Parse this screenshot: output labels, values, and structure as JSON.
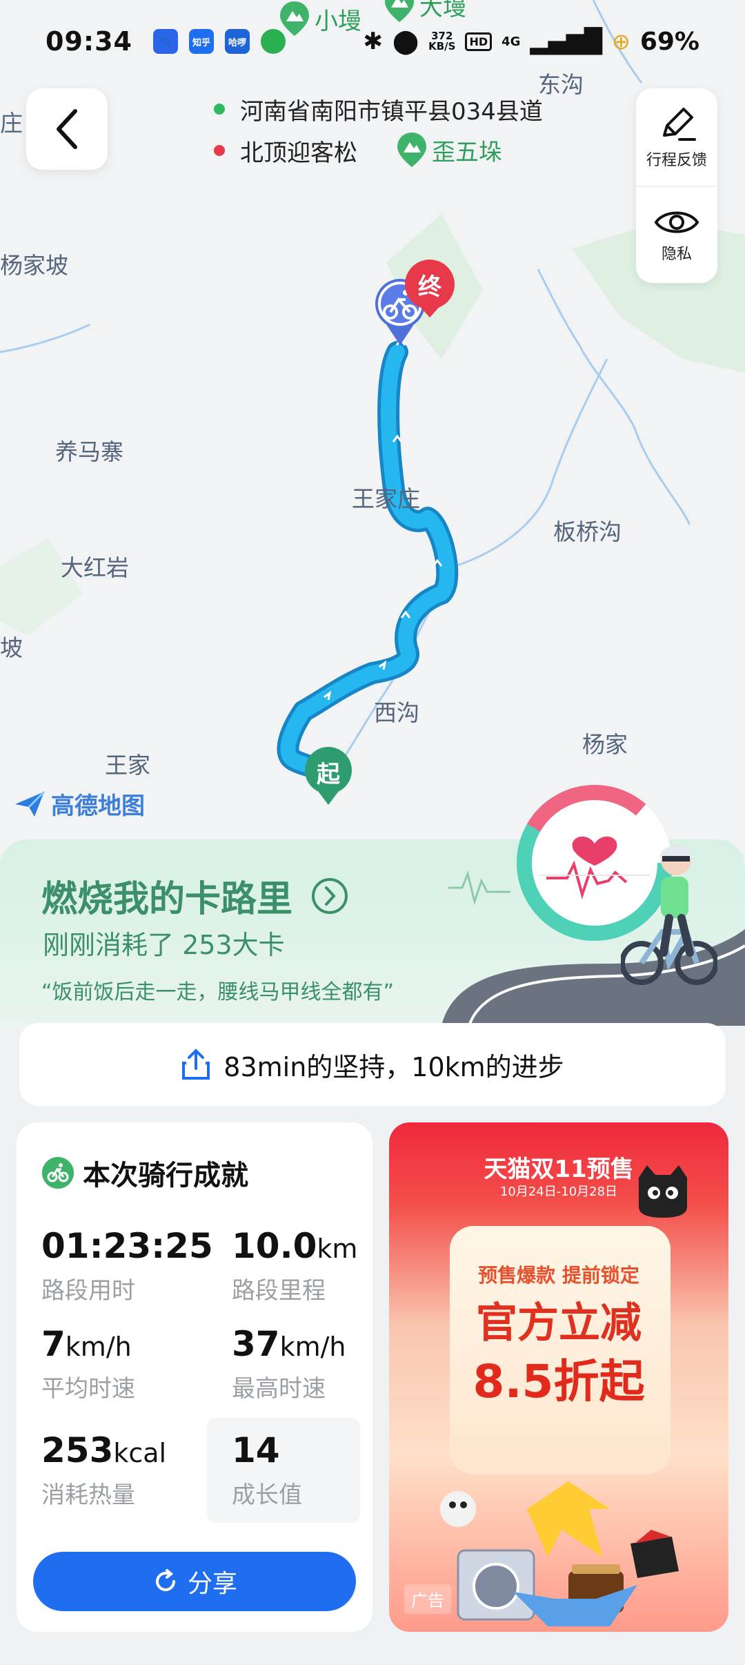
{
  "status_bar": {
    "time": "09:34",
    "apps": [
      {
        "name": "baidu-icon",
        "text": "🐾",
        "color": "#2a65e8"
      },
      {
        "name": "zhihu-icon",
        "text": "知乎",
        "color": "#1f6ef0"
      },
      {
        "name": "hello-icon",
        "text": "哈啰",
        "color": "#1e64d7"
      },
      {
        "name": "message-icon",
        "text": "",
        "color": "#2bb04f"
      }
    ],
    "net_speed_value": "372",
    "net_speed_unit": "KB/S",
    "hd": "HD",
    "network": "4G",
    "battery": "69%"
  },
  "map": {
    "start_address": "河南省南阳市镇平县034县道",
    "end_address": "北顶迎客松",
    "place_labels": [
      "庄",
      "东沟",
      "杨家坡",
      "养马寨",
      "王家庄",
      "板桥沟",
      "大红岩",
      "西沟",
      "杨家",
      "王家",
      "坡"
    ],
    "poi_labels": [
      "小墁",
      "大墁",
      "歪五垛"
    ],
    "end_marker": "终",
    "start_marker": "起",
    "provider": "高德地图"
  },
  "side_panel": {
    "feedback": "行程反馈",
    "privacy": "隐私"
  },
  "calorie": {
    "title": "燃烧我的卡路里",
    "subtitle": "刚刚消耗了 253大卡",
    "quote": "“饭前饭后走一走，腰线马甲线全都有”"
  },
  "share_strip": "83min的坚持，10km的进步",
  "achievement": {
    "title": "本次骑行成就",
    "duration": {
      "value": "01:23:25",
      "unit": "",
      "label": "路段用时"
    },
    "distance": {
      "value": "10.0",
      "unit": "km",
      "label": "路段里程"
    },
    "avg_speed": {
      "value": "7",
      "unit": "km/h",
      "label": "平均时速"
    },
    "max_speed": {
      "value": "37",
      "unit": "km/h",
      "label": "最高时速"
    },
    "calories": {
      "value": "253",
      "unit": "kcal",
      "label": "消耗热量"
    },
    "growth": {
      "value": "14",
      "unit": "",
      "label": "成长值"
    },
    "share_button": "分享"
  },
  "ad": {
    "header": "天猫双11预售",
    "dates": "10月24日-10月28日",
    "presale": "预售爆款 提前锁定",
    "main": "官方立减",
    "discount": "8.5折起",
    "label": "广告"
  },
  "colors": {
    "route": "#27a9e6",
    "accent_blue": "#1f6ef0",
    "calorie_green": "#3b8f69",
    "end_marker": "#e8394a",
    "start_marker": "#2e9c6e"
  }
}
